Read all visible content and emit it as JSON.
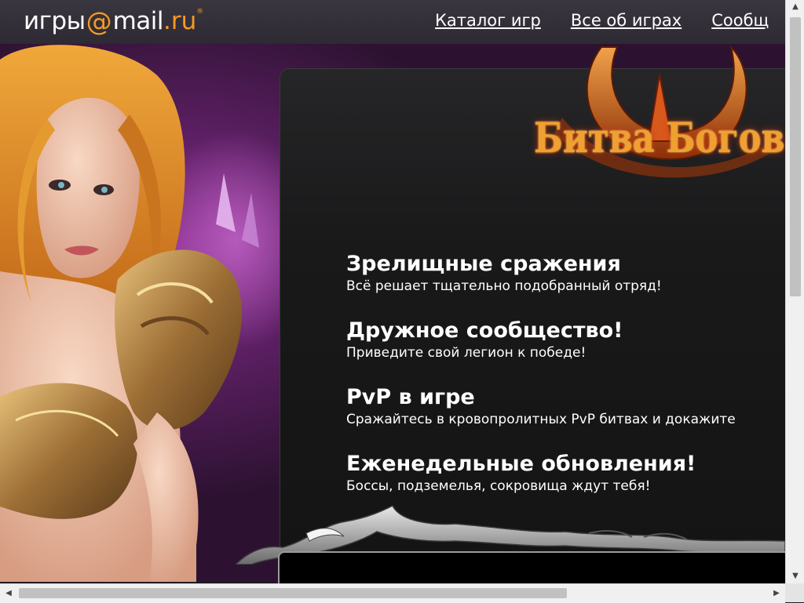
{
  "header": {
    "logo": {
      "prefix": "игры",
      "at": "@",
      "name": "mail",
      "suffix": ".ru",
      "registered": "®"
    },
    "nav": [
      {
        "label": "Каталог игр"
      },
      {
        "label": "Все об играх"
      },
      {
        "label": "Сообщ"
      }
    ]
  },
  "game": {
    "title": "Битва Богов",
    "features": [
      {
        "title": "Зрелищные сражения",
        "description": "Всё решает тщательно подобранный отряд!"
      },
      {
        "title": "Дружное сообщество!",
        "description": "Приведите свой легион к победе!"
      },
      {
        "title": "PvP в игре",
        "description": "Сражайтесь в кровопролитных PvP битвах и докажите"
      },
      {
        "title": "Еженедельные обновления!",
        "description": "Боссы, подземелья, сокровища ждут тебя!"
      }
    ]
  },
  "colors": {
    "header_bg": "#332f37",
    "logo_accent": "#f59a23",
    "hero_purple": "#6b2270",
    "panel_bg": "#1a1a1a",
    "title_orange": "#f0a030"
  },
  "icons": {
    "scroll_up": "arrow-up-icon",
    "scroll_down": "arrow-down-icon",
    "scroll_left": "arrow-left-icon",
    "scroll_right": "arrow-right-icon"
  },
  "scroll": {
    "vertical_thumb_fraction": 0.49,
    "horizontal_thumb_fraction": 0.7
  }
}
